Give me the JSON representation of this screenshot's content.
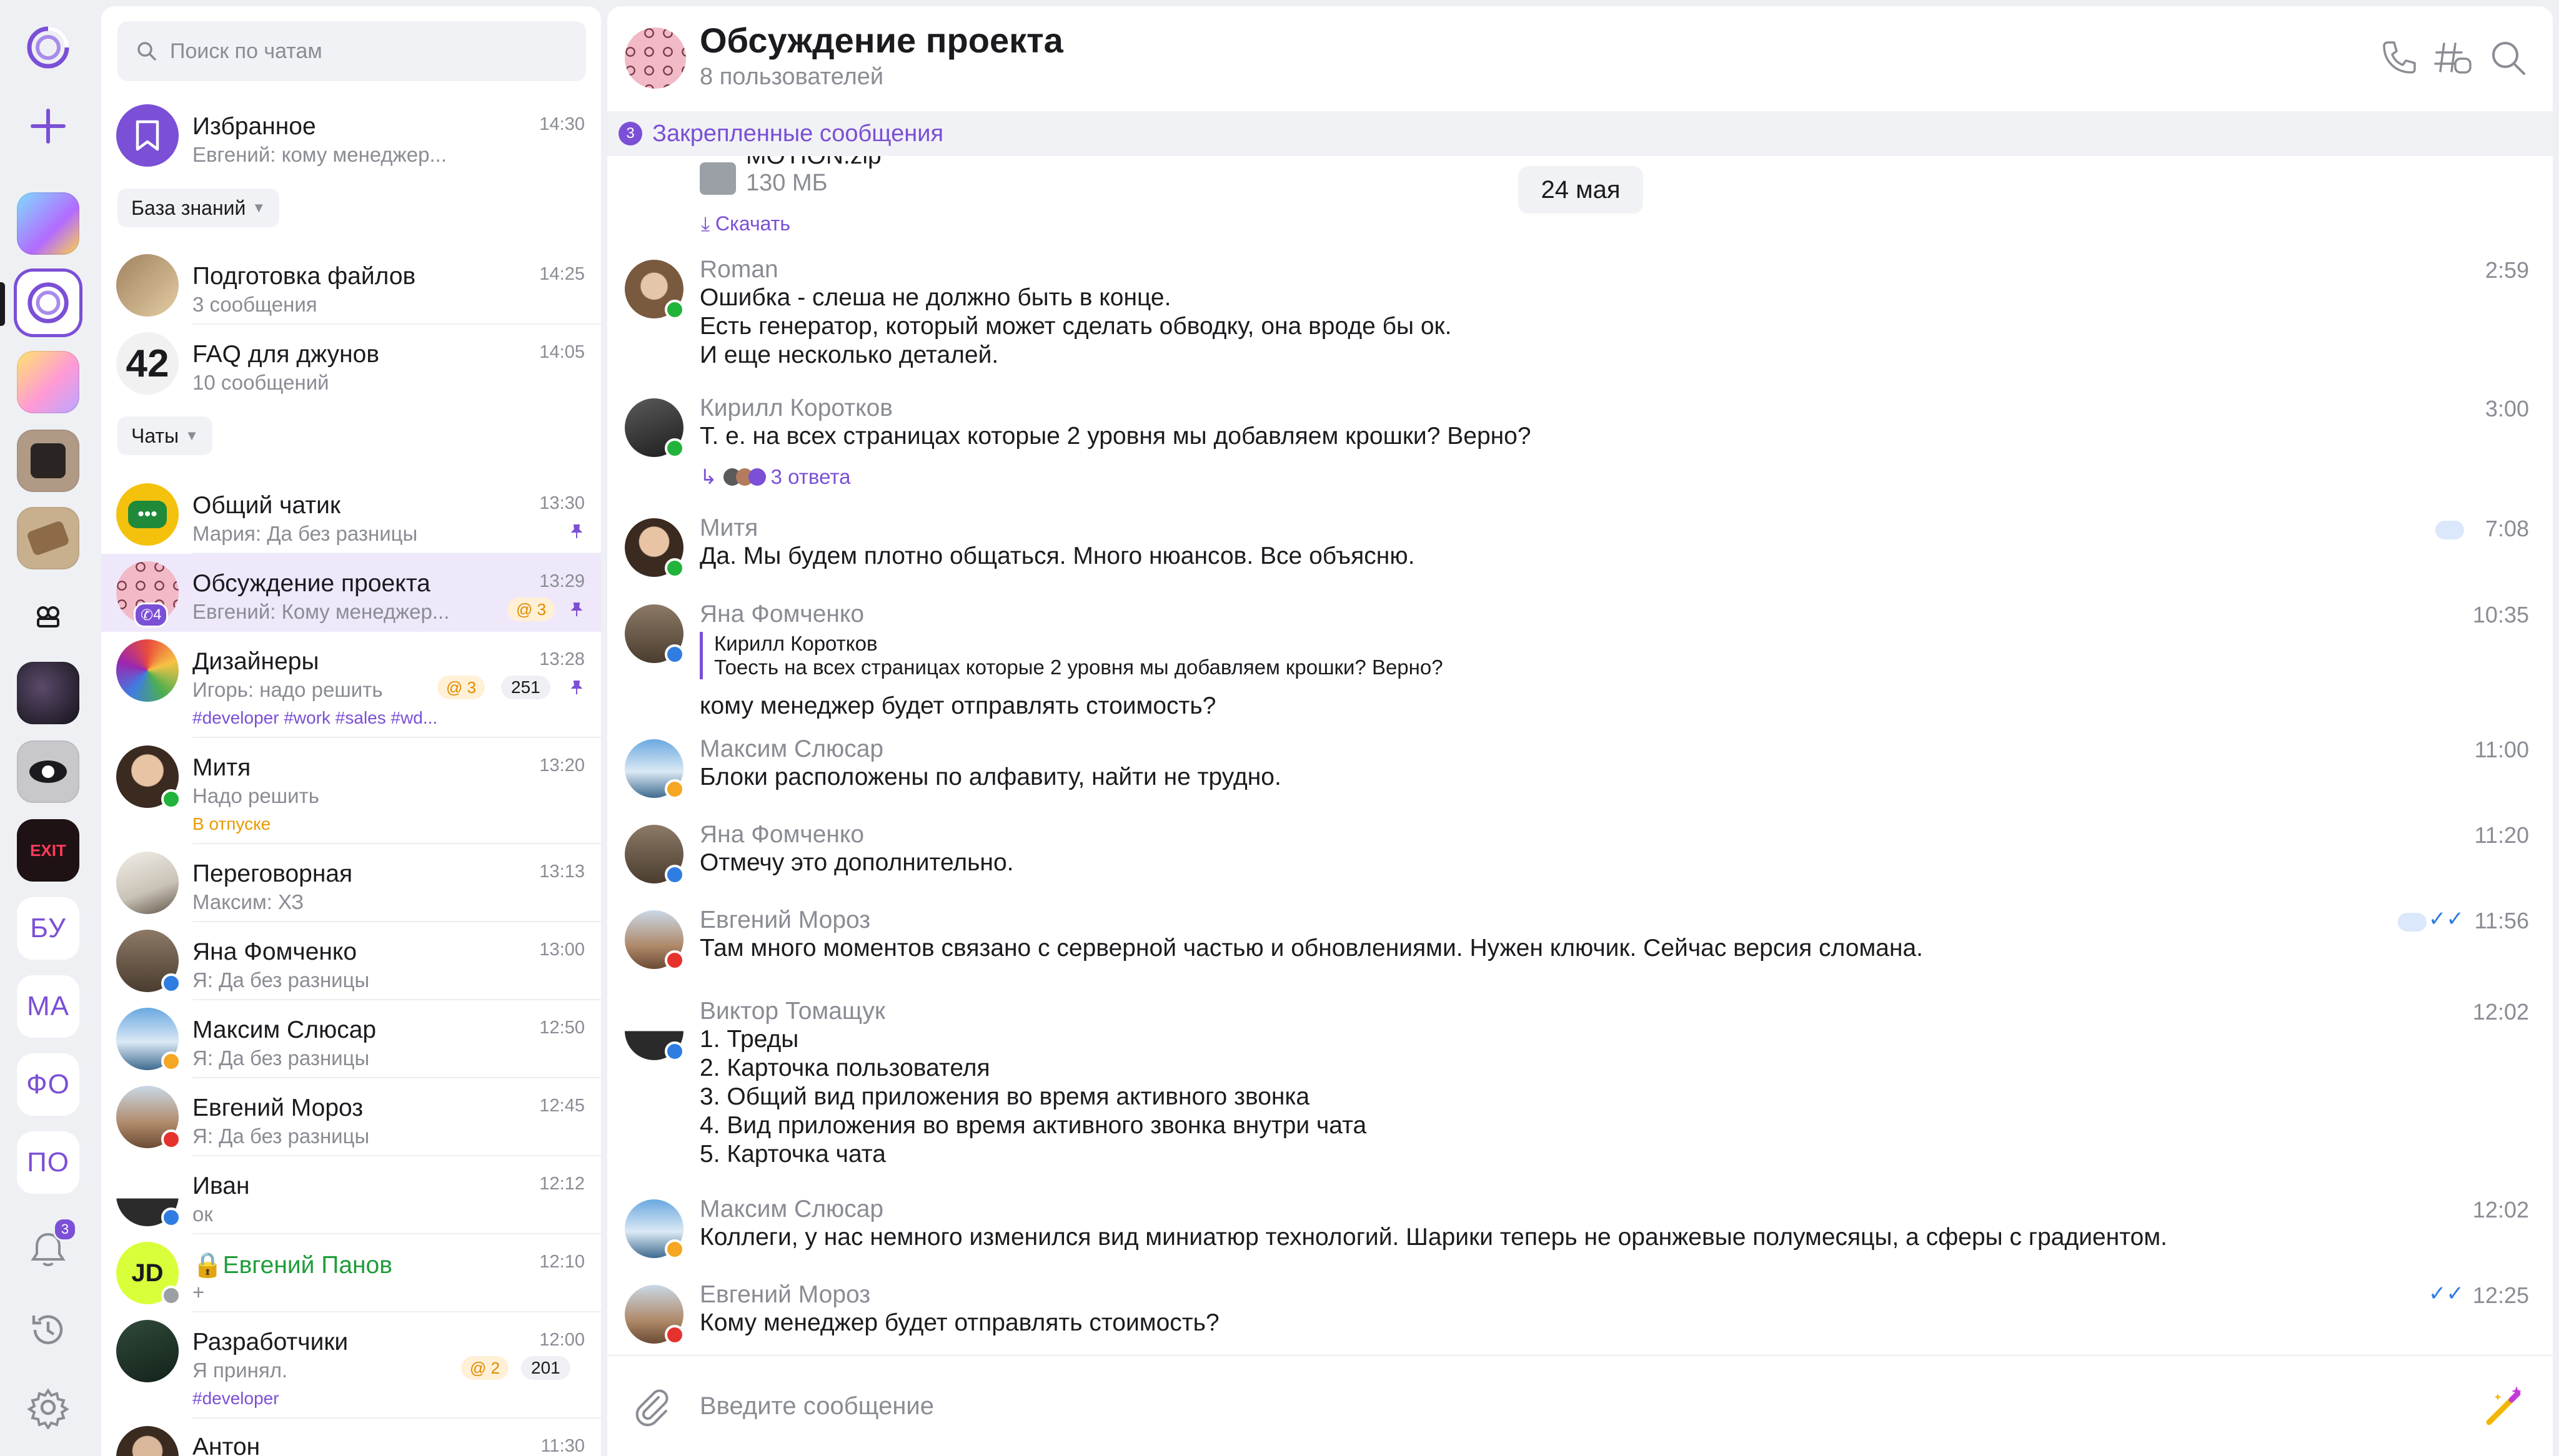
{
  "rail": {
    "items_text": [
      "БУ",
      "МА",
      "ФО",
      "ПО"
    ],
    "notifications_count": "3"
  },
  "search": {
    "placeholder": "Поиск по чатам"
  },
  "sections": {
    "knowledge": "База знаний",
    "chats": "Чаты"
  },
  "chats": [
    {
      "title": "Избранное",
      "sub": "Евгений: кому менеджер...",
      "time": "14:30"
    },
    {
      "title": "Подготовка файлов",
      "sub": "3 сообщения",
      "time": "14:25"
    },
    {
      "title": "FAQ для джунов",
      "sub": "10 сообщений",
      "time": "14:05"
    },
    {
      "title": "Общий чатик",
      "sub": "Мария: Да без разницы",
      "time": "13:30"
    },
    {
      "title": "Обсуждение проекта",
      "sub": "Евгений: Кому менеджер...",
      "time": "13:29",
      "mention": "@ 3",
      "call_count": "4"
    },
    {
      "title": "Дизайнеры",
      "sub": "Игорь: надо решить",
      "time": "13:28",
      "mention": "@ 3",
      "count": "251",
      "tags": "#developer #work #sales #wd..."
    },
    {
      "title": "Митя",
      "sub": "Надо решить",
      "time": "13:20",
      "note": "В отпуске"
    },
    {
      "title": "Переговорная",
      "sub": "Максим: ХЗ",
      "time": "13:13"
    },
    {
      "title": "Яна Фомченко",
      "sub": "Я: Да без разницы",
      "time": "13:00"
    },
    {
      "title": "Максим Слюсар",
      "sub": "Я: Да без разницы",
      "time": "12:50"
    },
    {
      "title": "Евгений Мороз",
      "sub": "Я: Да без разницы",
      "time": "12:45"
    },
    {
      "title": "Иван",
      "sub": "ок",
      "time": "12:12"
    },
    {
      "title": "Евгений Панов",
      "sub": "+",
      "time": "12:10"
    },
    {
      "title": "Разработчики",
      "sub": "Я принял.",
      "time": "12:00",
      "mention": "@ 2",
      "count": "201",
      "tags": "#developer"
    },
    {
      "title": "Антон",
      "sub": "",
      "time": "11:30"
    }
  ],
  "chat": {
    "title": "Обсуждение проекта",
    "subtitle": "8 пользователей",
    "pinned_count": "3",
    "pinned_label": "Закрепленные сообщения",
    "date_chip": "24 мая",
    "file": {
      "name": "MOTION.zip",
      "size": "130 МБ",
      "download": "Скачать"
    },
    "composer_placeholder": "Введите сообщение",
    "colors": {
      "accent": "#7b4fd6",
      "online": "#22b33a",
      "away": "#f5a623",
      "busy": "#e5322d",
      "info": "#2f7de1"
    },
    "messages": [
      {
        "author": "Roman",
        "time": "2:59",
        "text": "Ошибка - слеша не должно быть в конце.\nЕсть генератор, который может сделать обводку, она вроде бы ок.\nИ еще несколько деталей."
      },
      {
        "author": "Кирилл Коротков",
        "time": "3:00",
        "text": "Т. е. на всех страницах которые 2 уровня мы добавляем крошки? Верно?",
        "replies": "3 ответа"
      },
      {
        "author": "Митя",
        "time": "7:08",
        "text": "Да. Мы будем плотно общаться. Много нюансов. Все объясню."
      },
      {
        "author": "Яна Фомченко",
        "time": "10:35",
        "quote_author": "Кирилл Коротков",
        "quote_text": "Тоесть на всех страницах которые 2 уровня мы добавляем крошки? Верно?",
        "text": "кому менеджер будет отправлять стоимость?"
      },
      {
        "author": "Максим Слюсар",
        "time": "11:00",
        "text": "Блоки расположены по алфавиту, найти не трудно."
      },
      {
        "author": "Яна Фомченко",
        "time": "11:20",
        "text": "Отмечу это дополнительно."
      },
      {
        "author": "Евгений Мороз",
        "time": "11:56",
        "text": "Там много моментов связано с серверной частью и обновлениями. Нужен ключик. Сейчас версия сломана."
      },
      {
        "author": "Виктор Томащук",
        "time": "12:02",
        "text": "1. Треды\n2. Карточка пользователя\n3. Общий вид приложения во время активного звонка\n4. Вид приложения во время активного звонка внутри чата\n5. Карточка чата"
      },
      {
        "author": "Максим Слюсар",
        "time": "12:02",
        "text": "Коллеги, у нас немного изменился вид миниатюр технологий. Шарики теперь не оранжевые полумесяцы, а сферы с градиентом."
      },
      {
        "author": "Евгений Мороз",
        "time": "12:25",
        "text": "Кому менеджер будет отправлять стоимость?"
      }
    ]
  }
}
